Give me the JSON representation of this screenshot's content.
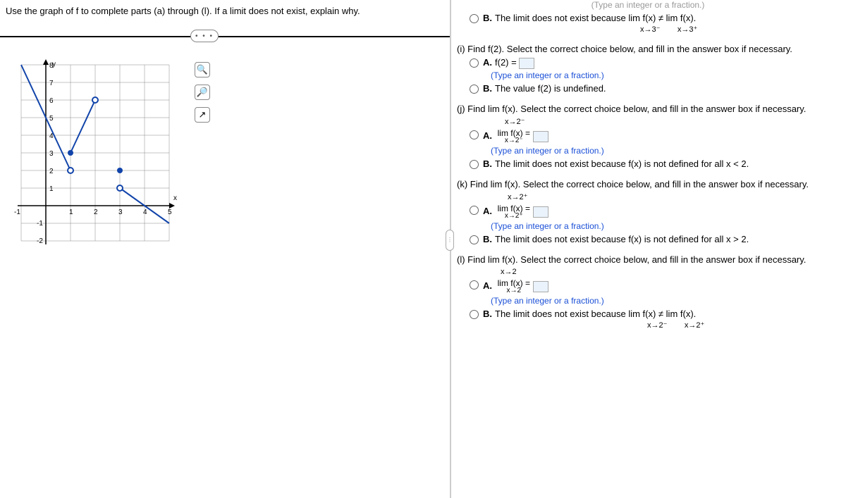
{
  "prompt": "Use the graph of f to complete parts (a) through (l). If a limit does not exist, explain why.",
  "faded_hint": "(Type an integer or a fraction.)",
  "top_option_B": "The limit does not exist because  lim  f(x) ≠  lim  f(x).",
  "top_B_sub_left": "x→3⁻",
  "top_B_sub_right": "x→3⁺",
  "qi": {
    "head": "(i) Find f(2). Select the correct choice below, and fill in the answer box if necessary.",
    "A_text": "f(2) =",
    "A_hint": "(Type an integer or a fraction.)",
    "B_text": "The value f(2) is undefined."
  },
  "qj": {
    "head": "(j) Find   lim  f(x). Select the correct choice below, and fill in the answer box if necessary.",
    "head_sub": "x→2⁻",
    "A_top": "lim  f(x) =",
    "A_sub": "x→2⁻",
    "A_hint": "(Type an integer or a fraction.)",
    "B_text": "The limit does not exist because f(x) is not defined for all x < 2."
  },
  "qk": {
    "head": "(k) Find   lim  f(x). Select the correct choice below, and fill in the answer box if necessary.",
    "head_sub": "x→2⁺",
    "A_top": "lim  f(x) =",
    "A_sub": "x→2⁺",
    "A_hint": "(Type an integer or a fraction.)",
    "B_text": "The limit does not exist because f(x) is not defined for all x > 2."
  },
  "ql": {
    "head": "(l) Find  lim f(x). Select the correct choice below, and fill in the answer box if necessary.",
    "head_sub": "x→2",
    "A_top": "lim f(x) =",
    "A_sub": "x→2",
    "A_hint": "(Type an integer or a fraction.)",
    "B_text": "The limit does not exist because   lim  f(x) ≠  lim  f(x).",
    "B_sub_left": "x→2⁻",
    "B_sub_right": "x→2⁺"
  },
  "labels": {
    "A": "A.",
    "B": "B.",
    "more": "• • •"
  },
  "chart_data": {
    "type": "line",
    "title": "",
    "xlabel": "x",
    "ylabel": "y",
    "xlim": [
      -1,
      5
    ],
    "ylim": [
      -2,
      8
    ],
    "x_ticks": [
      -1,
      1,
      2,
      3,
      4,
      5
    ],
    "y_ticks": [
      -2,
      -1,
      1,
      2,
      3,
      4,
      5,
      6,
      7,
      8
    ],
    "series": [
      {
        "name": "segment1",
        "points": [
          [
            -1,
            8
          ],
          [
            1,
            2
          ]
        ]
      },
      {
        "name": "segment2",
        "points": [
          [
            1,
            3
          ],
          [
            2,
            6
          ]
        ]
      },
      {
        "name": "segment3",
        "points": [
          [
            3,
            1
          ],
          [
            5,
            -1
          ]
        ]
      }
    ],
    "markers": [
      {
        "x": 1,
        "y": 2,
        "type": "open"
      },
      {
        "x": 1,
        "y": 3,
        "type": "closed"
      },
      {
        "x": 2,
        "y": 6,
        "type": "open"
      },
      {
        "x": 3,
        "y": 2,
        "type": "closed"
      },
      {
        "x": 3,
        "y": 1,
        "type": "open"
      }
    ]
  }
}
